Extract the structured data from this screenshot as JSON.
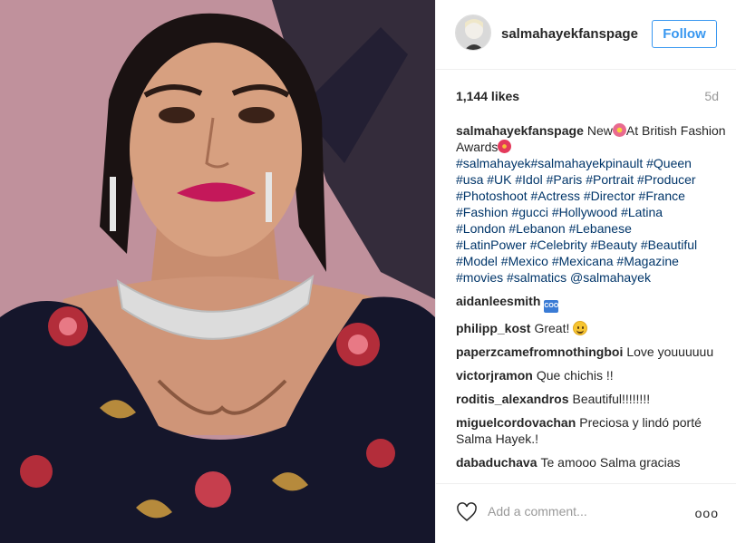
{
  "post": {
    "username": "salmahayekfanspage",
    "follow_label": "Follow",
    "likes": "1,144 likes",
    "age": "5d",
    "caption": {
      "author": "salmahayekfanspage",
      "text_before": "New",
      "text_after": "At British Fashion Awards",
      "hashtags": [
        "#salmahayek#salmahayekpinault #Queen",
        "#usa #UK #Idol #Paris #Portrait #Producer",
        "#Photoshoot #Actress #Director #France",
        "#Fashion #gucci #Hollywood #Latina",
        "#London #Lebanon #Lebanese",
        "#LatinPower #Celebrity #Beauty #Beautiful",
        "#Model #Mexico #Mexicana #Magazine",
        "#movies #salmatics @salmahayek"
      ]
    },
    "comments": [
      {
        "author": "aidanleesmith",
        "text": ""
      },
      {
        "author": "philipp_kost",
        "text": "Great!"
      },
      {
        "author": "paperzcamefromnothingboi",
        "text": "Love youuuuuu"
      },
      {
        "author": "victorjramon",
        "text": "Que chichis !!"
      },
      {
        "author": "roditis_alexandros",
        "text": "Beautiful!!!!!!!!"
      },
      {
        "author": "miguelcordovachan",
        "text": "Preciosa y lindó porté Salma Hayek.!"
      },
      {
        "author": "dabaduchava",
        "text": "Te amooo Salma gracias"
      }
    ],
    "add_comment_placeholder": "Add a comment...",
    "more_label": "ooo",
    "cool_emoji_text": "COOL"
  }
}
